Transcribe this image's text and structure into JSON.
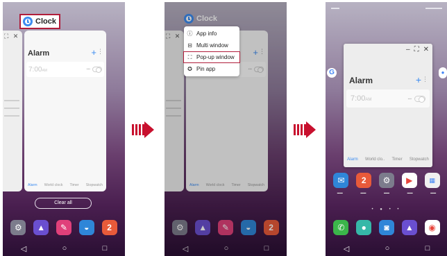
{
  "app": {
    "name": "Clock"
  },
  "card": {
    "title": "Alarm",
    "alarm_time": "7:00",
    "alarm_ampm": "AM",
    "tabs": [
      "Alarm",
      "World clock",
      "Timer",
      "Stopwatch"
    ]
  },
  "recents": {
    "clear_all": "Clear all"
  },
  "menu": {
    "items": [
      {
        "label": "App info",
        "icon": "info-icon"
      },
      {
        "label": "Multi window",
        "icon": "multi-window-icon"
      },
      {
        "label": "Pop-up window",
        "icon": "popup-window-icon"
      },
      {
        "label": "Pin app",
        "icon": "pin-icon"
      }
    ]
  },
  "popup": {
    "title": "Alarm",
    "alarm_time": "7:00",
    "alarm_ampm": "AM",
    "tabs": [
      "Alarm",
      "World clo..",
      "Timer",
      "Stopwatch"
    ]
  },
  "colors": {
    "highlight": "#b01c3a",
    "arrow": "#c8102e",
    "accent": "#3d8cf0"
  },
  "dock_icons": [
    "settings-icon",
    "gallery-icon",
    "pen-icon",
    "browser-icon",
    "calendar-icon"
  ],
  "home_row_icons": [
    "email-icon",
    "calendar-icon",
    "settings-icon",
    "play-store-icon",
    "google-folder-icon"
  ],
  "home_dock_icons": [
    "phone-icon",
    "messages-icon",
    "camera-icon",
    "gallery-icon",
    "chrome-icon"
  ],
  "calendar_number": "2"
}
